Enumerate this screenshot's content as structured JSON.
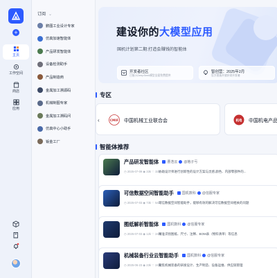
{
  "rail": {
    "items": [
      {
        "label": "主页",
        "icon": "home-icon"
      },
      {
        "label": "工作空间",
        "icon": "workspace-icon"
      },
      {
        "label": "商店",
        "icon": "store-icon"
      },
      {
        "label": "应用",
        "icon": "apps-icon"
      }
    ],
    "bottom_icons": [
      "box-icon",
      "book-icon",
      "bell-icon"
    ]
  },
  "panel": {
    "header": "订阅",
    "agents": [
      {
        "name": "鹏图工业设计专家",
        "color": "#6b7fa8"
      },
      {
        "name": "仿真加速智能体",
        "color": "#3b6fd1"
      },
      {
        "name": "产品研发智能体",
        "color": "#4a7a4e"
      },
      {
        "name": "设备检测助手",
        "color": "#6f6f7a"
      },
      {
        "name": "产品制造商",
        "color": "#8a5a3c"
      },
      {
        "name": "金属加工溯源码",
        "color": "#3d4a66"
      },
      {
        "name": "机械制图专家",
        "color": "#5a6a8a"
      },
      {
        "name": "金属加工溯码问",
        "color": "#6a7a5a"
      },
      {
        "name": "仿真中心小助手",
        "color": "#4a6aa8"
      },
      {
        "name": "钣金工厂",
        "color": "#7a6a5a"
      }
    ]
  },
  "hero": {
    "title_pre": "建设你的",
    "title_hl": "大模型应用",
    "subtitle": "国机计划第二期:打造会赚钱的智能体",
    "cards": [
      {
        "title": "开发者社区",
        "sub": "已接入DeepSeek模型全面免费提供"
      },
      {
        "title": "智创营：2025年2月",
        "sub": "官方营造开放好奇开发者"
      }
    ]
  },
  "zones": {
    "title": "专区",
    "items": [
      {
        "name": "中国机械工业联合会",
        "logo_text": "CMIF"
      },
      {
        "name": "中国机电产品",
        "logo_text": "机电"
      }
    ]
  },
  "recommend": {
    "title": "智能体推荐",
    "items": [
      {
        "title": "产品研发智能体",
        "org": "曹浩云",
        "tag": "@格子亏",
        "date": "2025-07-09",
        "views": "33k",
        "likes": "334",
        "desc": "协助设计师进行创新性的设计方案与灵感,颜色、内部零部件的...",
        "thumb": "#4a7a4e"
      },
      {
        "title": "可信数据空间智能助手",
        "org": "国机数科",
        "tag": "@信服专家",
        "date": "2025-07-03",
        "views": "73k",
        "likes": "5434",
        "desc": "可信数据空间智能助手，能够有效的解决可信数据空间相关的问题",
        "thumb": "#2b5fb8"
      },
      {
        "title": "图纸解析智能体",
        "org": "国机数科",
        "tag": "@信服专家",
        "date": "2025-07-03",
        "views": "12k",
        "likes": "2434",
        "desc": "精准识别图纸、尺寸、注释、BOM表（物料清单）等信息",
        "thumb": "#1f3a6e"
      },
      {
        "title": "机械装备行业云智能助手",
        "org": "国机数科",
        "tag": "@信服专家",
        "date": "2025-06-23",
        "views": "23k",
        "likes": "2434",
        "desc": "聚焦机械装备的研发设计、生产制造、设备运维、供应链管理",
        "thumb": "#2a3c7a"
      }
    ]
  },
  "colors": {
    "accent": "#2d5bff"
  }
}
